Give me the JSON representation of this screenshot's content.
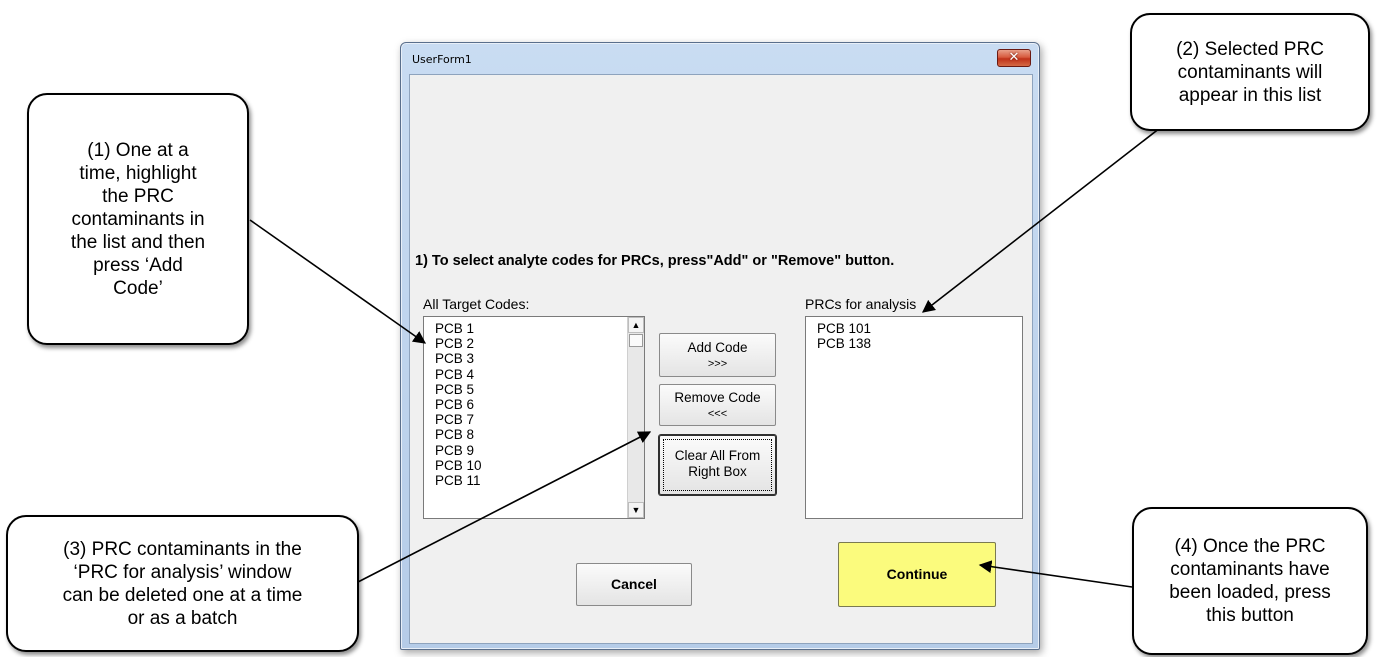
{
  "window": {
    "title": "UserForm1",
    "close_glyph": "✕"
  },
  "form": {
    "instruction": "1) To select analyte codes for PRCs, press\"Add\" or \"Remove\" button.",
    "left_list_label": "All Target Codes:",
    "right_list_label": "PRCs for analysis",
    "left_list_items": [
      "PCB 1",
      "PCB 2",
      "PCB 3",
      "PCB 4",
      "PCB 5",
      "PCB 6",
      "PCB 7",
      "PCB 8",
      "PCB 9",
      "PCB 10",
      "PCB 11"
    ],
    "right_list_items": [
      "PCB 101",
      "PCB 138"
    ],
    "add_button": {
      "line1": "Add Code",
      "line2": ">>>"
    },
    "remove_button": {
      "line1": "Remove Code",
      "line2": "<<<"
    },
    "clear_button": {
      "line1": "Clear All From",
      "line2": "Right Box"
    },
    "cancel_button": "Cancel",
    "continue_button": "Continue",
    "scroll_up_glyph": "▲",
    "scroll_down_glyph": "▼"
  },
  "callouts": {
    "step1": "(1) One at a\ntime, highlight\nthe PRC\ncontaminants in\nthe list and then\npress ‘Add\nCode’",
    "step2": "(2) Selected PRC\ncontaminants will\nappear in this list",
    "step3": "(3) PRC contaminants in the\n‘PRC for analysis’ window\ncan be deleted one at a time\nor as a batch",
    "step4": "(4) Once the PRC\ncontaminants have\nbeen loaded, press\nthis button"
  },
  "colors": {
    "continue_bg": "#fbfb7d",
    "title_bar": "#c9dcf2",
    "close_button": "#c0321a"
  }
}
